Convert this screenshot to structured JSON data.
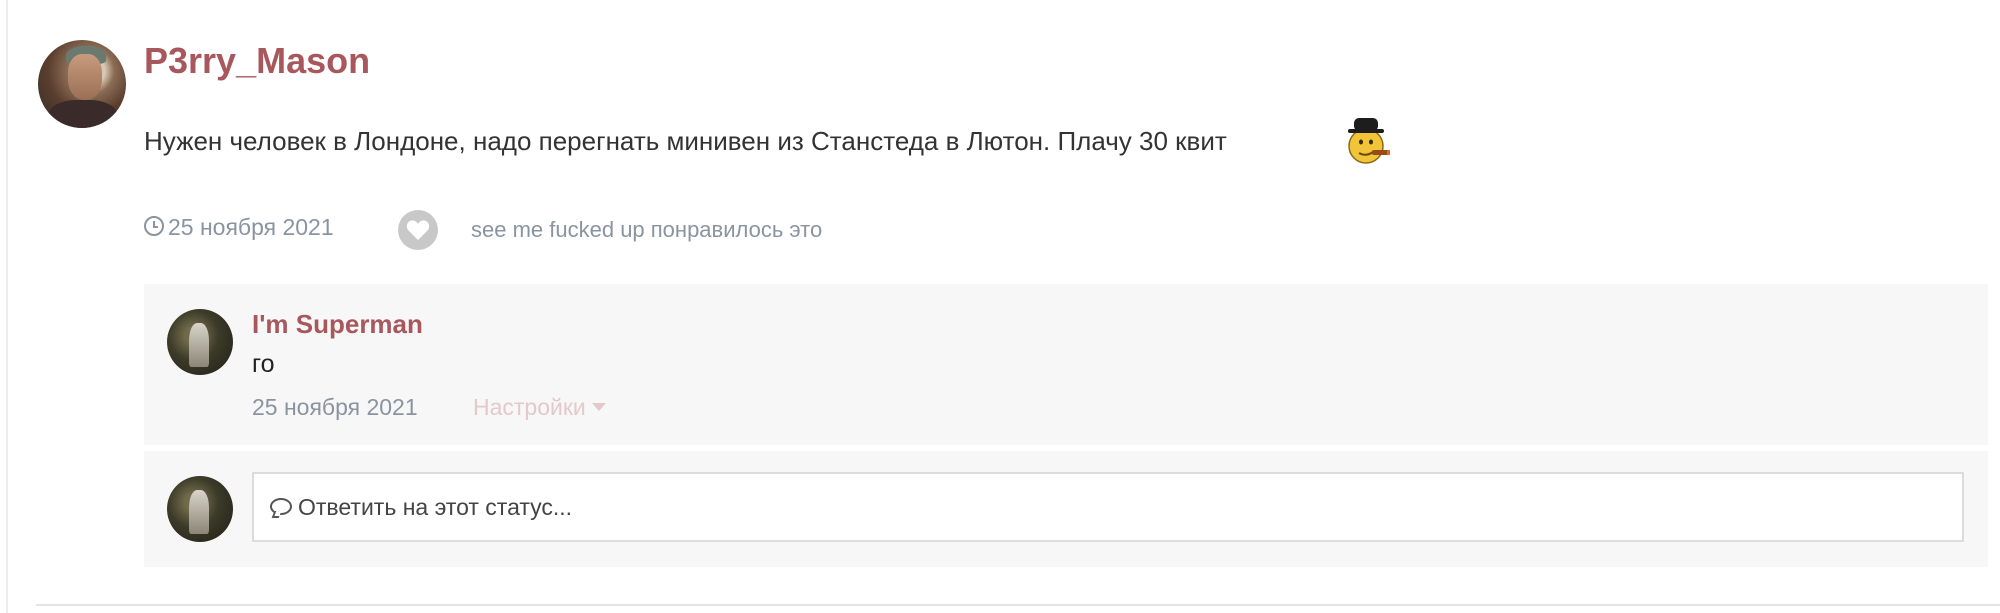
{
  "status": {
    "author": "P3rry_Mason",
    "text": "Нужен человек в Лондоне, надо перегнать минивен из Станстеда в Лютон. Плачу 30 квит",
    "emoji": "smiley-with-hat-and-cigar",
    "date": "25 ноября 2021",
    "likes_text": "see me fucked up понравилось это",
    "icons": {
      "clock": "clock-icon",
      "like": "heart-icon"
    }
  },
  "comments": [
    {
      "author": "I'm Superman",
      "text": "го",
      "date": "25 ноября 2021",
      "options_label": "Настройки"
    }
  ],
  "reply": {
    "placeholder": "Ответить на этот статус...",
    "icon": "comment-icon"
  },
  "colors": {
    "author": "#a8585c",
    "meta": "#8a94a1",
    "options": "#e3c9ca",
    "panel_bg": "#f7f7f7"
  }
}
